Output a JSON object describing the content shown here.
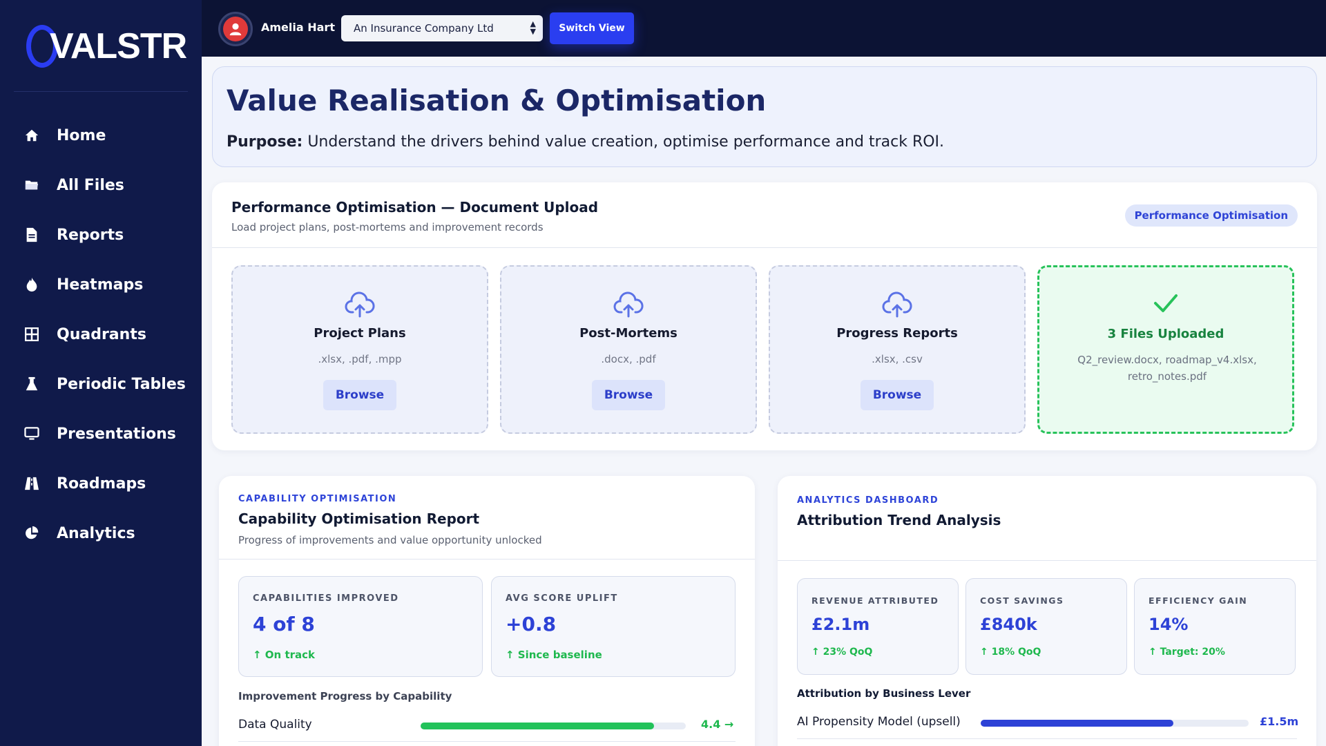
{
  "brand": {
    "logo_text": "VALSTR"
  },
  "sidebar": {
    "items": [
      {
        "label": "Home",
        "icon": "home-icon"
      },
      {
        "label": "All Files",
        "icon": "folder-icon"
      },
      {
        "label": "Reports",
        "icon": "document-icon"
      },
      {
        "label": "Heatmaps",
        "icon": "flame-icon"
      },
      {
        "label": "Quadrants",
        "icon": "grid-icon"
      },
      {
        "label": "Periodic Tables",
        "icon": "flask-icon"
      },
      {
        "label": "Presentations",
        "icon": "monitor-icon"
      },
      {
        "label": "Roadmaps",
        "icon": "road-icon"
      },
      {
        "label": "Analytics",
        "icon": "pie-chart-icon"
      }
    ]
  },
  "topbar": {
    "user_name": "Amelia Hart",
    "company_selected": "An Insurance Company Ltd",
    "switch_label": "Switch View"
  },
  "header": {
    "title": "Value Realisation & Optimisation",
    "purpose_label": "Purpose:",
    "purpose_text": "Understand the drivers behind value creation, optimise performance and track ROI."
  },
  "upload": {
    "title": "Performance Optimisation — Document Upload",
    "subtitle": "Load project plans, post-mortems and improvement records",
    "badge": "Performance Optimisation",
    "zones": [
      {
        "title": "Project Plans",
        "formats": ".xlsx, .pdf, .mpp",
        "button": "Browse"
      },
      {
        "title": "Post-Mortems",
        "formats": ".docx, .pdf",
        "button": "Browse"
      },
      {
        "title": "Progress Reports",
        "formats": ".xlsx, .csv",
        "button": "Browse"
      }
    ],
    "success": {
      "title": "3 Files Uploaded",
      "files": "Q2_review.docx, roadmap_v4.xlsx, retro_notes.pdf"
    }
  },
  "capability": {
    "eyebrow": "CAPABILITY OPTIMISATION",
    "title": "Capability Optimisation Report",
    "subtitle": "Progress of improvements and value opportunity unlocked",
    "metrics": [
      {
        "label": "CAPABILITIES IMPROVED",
        "value": "4 of 8",
        "delta": "↑ On track"
      },
      {
        "label": "AVG SCORE UPLIFT",
        "value": "+0.8",
        "delta": "↑ Since baseline"
      }
    ],
    "section_label": "Improvement Progress by Capability",
    "rows": [
      {
        "label": "Data Quality",
        "progress": 0.88,
        "value": "4.4 →"
      }
    ]
  },
  "analytics": {
    "eyebrow": "ANALYTICS DASHBOARD",
    "title": "Attribution Trend Analysis",
    "metrics": [
      {
        "label": "REVENUE ATTRIBUTED",
        "value": "£2.1m",
        "delta": "↑ 23% QoQ"
      },
      {
        "label": "COST SAVINGS",
        "value": "£840k",
        "delta": "↑ 18% QoQ"
      },
      {
        "label": "EFFICIENCY GAIN",
        "value": "14%",
        "delta": "↑ Target: 20%"
      }
    ],
    "section_label": "Attribution by Business Lever",
    "rows": [
      {
        "label": "AI Propensity Model (upsell)",
        "progress": 0.72,
        "value": "£1.5m"
      }
    ]
  },
  "colors": {
    "sidebar_bg": "#101a4a",
    "topbar_bg": "#0c1334",
    "accent": "#2a3ef0",
    "success": "#27c25a"
  }
}
